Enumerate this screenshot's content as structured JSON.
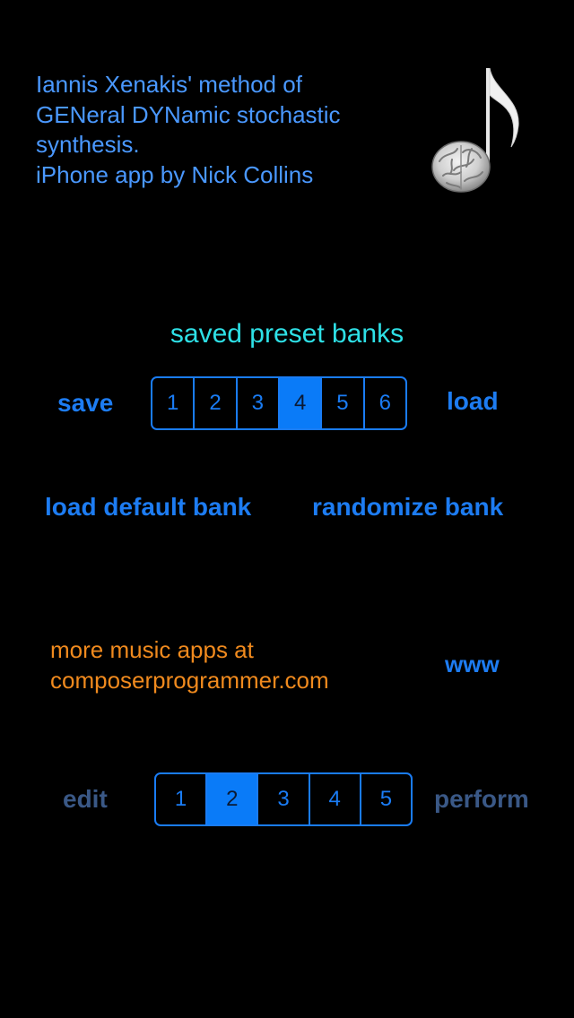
{
  "intro": {
    "line1": "Iannis Xenakis' method of",
    "line2": "GENeral DYNamic stochastic",
    "line3": "synthesis.",
    "line4": "iPhone app by Nick Collins"
  },
  "logo": {
    "icon": "brain-music-note-icon"
  },
  "presets": {
    "title": "saved preset banks",
    "save_label": "save",
    "load_label": "load",
    "slots": [
      "1",
      "2",
      "3",
      "4",
      "5",
      "6"
    ],
    "selected": "4"
  },
  "bank_actions": {
    "load_default": "load default bank",
    "randomize": "randomize bank"
  },
  "promo": {
    "line1": "more music apps at",
    "line2": "composerprogrammer.com",
    "www_label": "www"
  },
  "mode": {
    "edit_label": "edit",
    "perform_label": "perform",
    "slots": [
      "1",
      "2",
      "3",
      "4",
      "5"
    ],
    "selected": "2"
  },
  "colors": {
    "background": "#000000",
    "accent_blue": "#1a7cf4",
    "title_cyan": "#2ee0e6",
    "link_orange": "#f08a1e",
    "dim_blue": "#3a5886"
  }
}
